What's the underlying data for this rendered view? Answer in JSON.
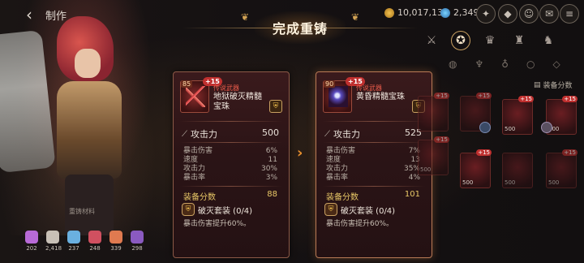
{
  "header": {
    "back_label": "制作",
    "gold": "10,017,136",
    "gems": "2,349"
  },
  "banner": {
    "title": "完成重铸"
  },
  "side": {
    "equip_label": "装备分数"
  },
  "before": {
    "level": "85",
    "plus": "+15",
    "grade": "传说武器",
    "name": "地狱破灭精髓宝珠",
    "atk_label": "攻击力",
    "atk_value": "500",
    "stats": [
      {
        "label": "暴击伤害",
        "value": "6%"
      },
      {
        "label": "速度",
        "value": "11"
      },
      {
        "label": "攻击力",
        "value": "30%"
      },
      {
        "label": "暴击率",
        "value": "3%"
      }
    ],
    "score_label": "装备分数",
    "score_value": "88",
    "set_name": "破灭套装 (0/4)",
    "set_desc": "暴击伤害提升60%。"
  },
  "after": {
    "level": "90",
    "plus": "+15",
    "grade": "传说武器",
    "name": "黄昏精髓宝珠",
    "atk_label": "攻击力",
    "atk_value": "525",
    "stats": [
      {
        "label": "暴击伤害",
        "value": "7%"
      },
      {
        "label": "速度",
        "value": "13"
      },
      {
        "label": "攻击力",
        "value": "35%"
      },
      {
        "label": "暴击率",
        "value": "4%"
      }
    ],
    "score_label": "装备分数",
    "score_value": "101",
    "set_name": "破灭套装 (0/4)",
    "set_desc": "暴击伤害提升60%。"
  },
  "materials_label": "重铸材料",
  "materials": [
    {
      "count": "202",
      "color": "#b86ad6"
    },
    {
      "count": "2,418",
      "color": "#c8c0b6"
    },
    {
      "count": "237",
      "color": "#6ab0e0"
    },
    {
      "count": "248",
      "color": "#d05060"
    },
    {
      "count": "339",
      "color": "#e07a50"
    },
    {
      "count": "298",
      "color": "#8a5ac0"
    }
  ],
  "inventory": [
    {
      "plus": "+15",
      "value": ""
    },
    {
      "plus": "+15",
      "value": ""
    },
    {
      "plus": "+15",
      "value": "500"
    },
    {
      "plus": "+15",
      "value": "500"
    },
    {
      "plus": "+15",
      "value": "500"
    },
    {
      "plus": "+15",
      "value": "500"
    },
    {
      "plus": "",
      "value": "500"
    },
    {
      "plus": "+15",
      "value": "500"
    }
  ]
}
